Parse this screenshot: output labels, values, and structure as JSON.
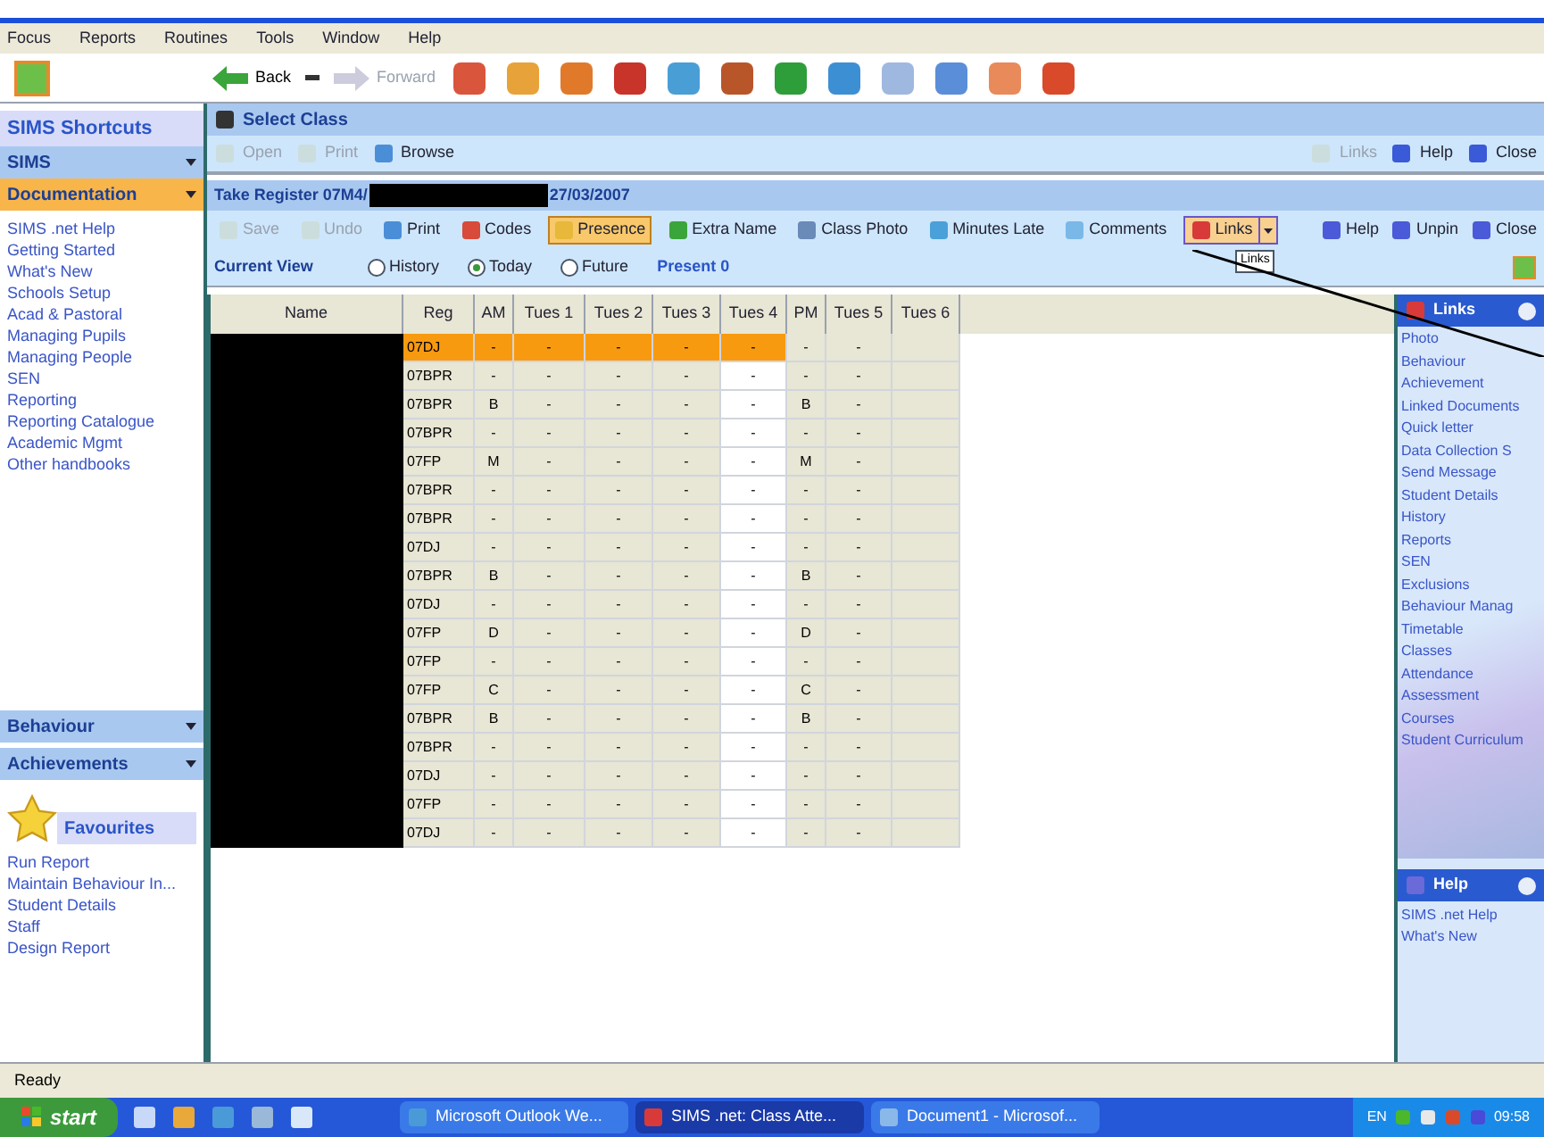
{
  "menu": [
    "Focus",
    "Reports",
    "Routines",
    "Tools",
    "Window",
    "Help"
  ],
  "nav": {
    "back": "Back",
    "forward": "Forward"
  },
  "sidebar": {
    "title": "SIMS Shortcuts",
    "groups": [
      {
        "label": "SIMS",
        "active": false
      },
      {
        "label": "Documentation",
        "active": true
      }
    ],
    "doc_links": [
      "SIMS .net Help",
      "Getting Started",
      "What's New",
      "Schools Setup",
      "Acad & Pastoral",
      "Managing Pupils",
      "Managing People",
      "SEN",
      "Reporting",
      "Reporting Catalogue",
      "Academic Mgmt",
      "Other handbooks"
    ],
    "bottom_groups": [
      {
        "label": "Behaviour",
        "active": false
      },
      {
        "label": "Achievements",
        "active": false
      }
    ],
    "favourites": {
      "title": "Favourites",
      "items": [
        "Run Report",
        "Maintain Behaviour In...",
        "Student Details",
        "Staff",
        "Design Report"
      ]
    }
  },
  "select_class": {
    "title": "Select Class",
    "tools": [
      {
        "label": "Open",
        "disabled": true
      },
      {
        "label": "Print",
        "disabled": true
      },
      {
        "label": "Browse",
        "disabled": false
      }
    ],
    "right_tools": [
      {
        "label": "Links",
        "disabled": true
      },
      {
        "label": "Help",
        "disabled": false
      },
      {
        "label": "Close",
        "disabled": false
      }
    ]
  },
  "register": {
    "title": "Take Register 07M4/",
    "date": "27/03/2007",
    "tools": [
      {
        "label": "Save",
        "disabled": true,
        "selected": false
      },
      {
        "label": "Undo",
        "disabled": true,
        "selected": false
      },
      {
        "label": "Print",
        "disabled": false,
        "selected": false
      },
      {
        "label": "Codes",
        "disabled": false,
        "selected": false
      },
      {
        "label": "Presence",
        "disabled": false,
        "selected": true
      },
      {
        "label": "Extra Name",
        "disabled": false,
        "selected": false
      },
      {
        "label": "Class Photo",
        "disabled": false,
        "selected": false
      },
      {
        "label": "Minutes Late",
        "disabled": false,
        "selected": false
      },
      {
        "label": "Comments",
        "disabled": false,
        "selected": false
      }
    ],
    "links_button": "Links",
    "tooltip": "Links",
    "right_tools": [
      "Help",
      "Unpin",
      "Close"
    ],
    "view_label": "Current View",
    "views": [
      {
        "label": "History",
        "selected": false
      },
      {
        "label": "Today",
        "selected": true
      },
      {
        "label": "Future",
        "selected": false
      }
    ],
    "present": "Present 0",
    "columns": [
      "Name",
      "Reg",
      "AM",
      "Tues 1",
      "Tues 2",
      "Tues 3",
      "Tues 4",
      "PM",
      "Tues 5",
      "Tues 6"
    ],
    "rows": [
      {
        "reg": "07DJ",
        "marks": [
          "-",
          "-",
          "-",
          "-",
          "-",
          "-",
          "-"
        ],
        "selected": true
      },
      {
        "reg": "07BPR",
        "marks": [
          "-",
          "-",
          "-",
          "-",
          "-",
          "-",
          "-"
        ],
        "selected": false
      },
      {
        "reg": "07BPR",
        "marks": [
          "B",
          "-",
          "-",
          "-",
          "-",
          "B",
          "-"
        ],
        "selected": false
      },
      {
        "reg": "07BPR",
        "marks": [
          "-",
          "-",
          "-",
          "-",
          "-",
          "-",
          "-"
        ],
        "selected": false
      },
      {
        "reg": "07FP",
        "marks": [
          "M",
          "-",
          "-",
          "-",
          "-",
          "M",
          "-"
        ],
        "selected": false
      },
      {
        "reg": "07BPR",
        "marks": [
          "-",
          "-",
          "-",
          "-",
          "-",
          "-",
          "-"
        ],
        "selected": false
      },
      {
        "reg": "07BPR",
        "marks": [
          "-",
          "-",
          "-",
          "-",
          "-",
          "-",
          "-"
        ],
        "selected": false
      },
      {
        "reg": "07DJ",
        "marks": [
          "-",
          "-",
          "-",
          "-",
          "-",
          "-",
          "-"
        ],
        "selected": false
      },
      {
        "reg": "07BPR",
        "marks": [
          "B",
          "-",
          "-",
          "-",
          "-",
          "B",
          "-"
        ],
        "selected": false
      },
      {
        "reg": "07DJ",
        "marks": [
          "-",
          "-",
          "-",
          "-",
          "-",
          "-",
          "-"
        ],
        "selected": false
      },
      {
        "reg": "07FP",
        "marks": [
          "D",
          "-",
          "-",
          "-",
          "-",
          "D",
          "-"
        ],
        "selected": false
      },
      {
        "reg": "07FP",
        "marks": [
          "-",
          "-",
          "-",
          "-",
          "-",
          "-",
          "-"
        ],
        "selected": false
      },
      {
        "reg": "07FP",
        "marks": [
          "C",
          "-",
          "-",
          "-",
          "-",
          "C",
          "-"
        ],
        "selected": false
      },
      {
        "reg": "07BPR",
        "marks": [
          "B",
          "-",
          "-",
          "-",
          "-",
          "B",
          "-"
        ],
        "selected": false
      },
      {
        "reg": "07BPR",
        "marks": [
          "-",
          "-",
          "-",
          "-",
          "-",
          "-",
          "-"
        ],
        "selected": false
      },
      {
        "reg": "07DJ",
        "marks": [
          "-",
          "-",
          "-",
          "-",
          "-",
          "-",
          "-"
        ],
        "selected": false
      },
      {
        "reg": "07FP",
        "marks": [
          "-",
          "-",
          "-",
          "-",
          "-",
          "-",
          "-"
        ],
        "selected": false
      },
      {
        "reg": "07DJ",
        "marks": [
          "-",
          "-",
          "-",
          "-",
          "-",
          "-",
          "-"
        ],
        "selected": false
      }
    ]
  },
  "links_panel": {
    "title": "Links",
    "items": [
      "Photo",
      "Behaviour",
      "Achievement",
      "Linked Documents",
      "Quick letter",
      "Data Collection S",
      "Send Message",
      "Student Details",
      "History",
      "Reports",
      "SEN",
      "Exclusions",
      "Behaviour Manag",
      "Timetable",
      "Classes",
      "Attendance",
      "Assessment",
      "Courses",
      "Student Curriculum"
    ]
  },
  "help_panel": {
    "title": "Help",
    "items": [
      "SIMS .net Help",
      "What's New"
    ]
  },
  "status_bar": "Ready",
  "taskbar": {
    "start": "start",
    "tasks": [
      {
        "label": "Microsoft Outlook We...",
        "selected": false
      },
      {
        "label": "SIMS .net: Class Atte...",
        "selected": true
      },
      {
        "label": "Document1 - Microsof...",
        "selected": false
      }
    ],
    "language": "EN",
    "time": "09:58"
  }
}
